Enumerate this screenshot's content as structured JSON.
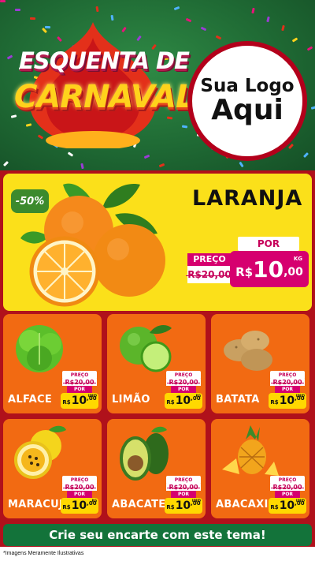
{
  "header": {
    "title_line1": "ESQUENTA DE",
    "title_line2": "CARNAVAL",
    "logo_line1": "Sua Logo",
    "logo_line2": "Aqui"
  },
  "hero": {
    "discount": "-50%",
    "name": "LARANJA",
    "por_label": "POR",
    "preco_label": "PREÇO",
    "old_price": "R$20,00",
    "currency": "R$",
    "price_int": "10",
    "price_cents": ",00",
    "unit": "KG"
  },
  "products": [
    {
      "name": "ALFACE",
      "preco_label": "PREÇO",
      "old_price": "R$20,00",
      "por_label": "POR",
      "currency": "R$",
      "price_int": "10",
      "price_cents": ",00",
      "unit": "UNID"
    },
    {
      "name": "LIMÃO",
      "preco_label": "PREÇO",
      "old_price": "R$20,00",
      "por_label": "POR",
      "currency": "R$",
      "price_int": "10",
      "price_cents": ",00",
      "unit": "KG"
    },
    {
      "name": "BATATA",
      "preco_label": "PREÇO",
      "old_price": "R$20,00",
      "por_label": "POR",
      "currency": "R$",
      "price_int": "10",
      "price_cents": ",00",
      "unit": "UNID"
    },
    {
      "name": "MARACUJÁ",
      "preco_label": "PREÇO",
      "old_price": "R$20,00",
      "por_label": "POR",
      "currency": "R$",
      "price_int": "10",
      "price_cents": ",00",
      "unit": "KG"
    },
    {
      "name": "ABACATE",
      "preco_label": "PREÇO",
      "old_price": "R$20,00",
      "por_label": "POR",
      "currency": "R$",
      "price_int": "10",
      "price_cents": ",00",
      "unit": "UNID"
    },
    {
      "name": "ABACAXI",
      "preco_label": "PREÇO",
      "old_price": "R$20,00",
      "por_label": "POR",
      "currency": "R$",
      "price_int": "10",
      "price_cents": ",00",
      "unit": "UNID"
    }
  ],
  "cta": "Crie seu encarte com este tema!",
  "footnote": "*Imagens Meramente Ilustrativas",
  "colors": {
    "header_green": "#1f6a34",
    "body_red": "#b0111b",
    "hero_yellow": "#fbe01a",
    "card_orange": "#f26a12",
    "price_magenta": "#d6006f",
    "price_yellow": "#ffd800",
    "cta_green": "#13733a"
  }
}
